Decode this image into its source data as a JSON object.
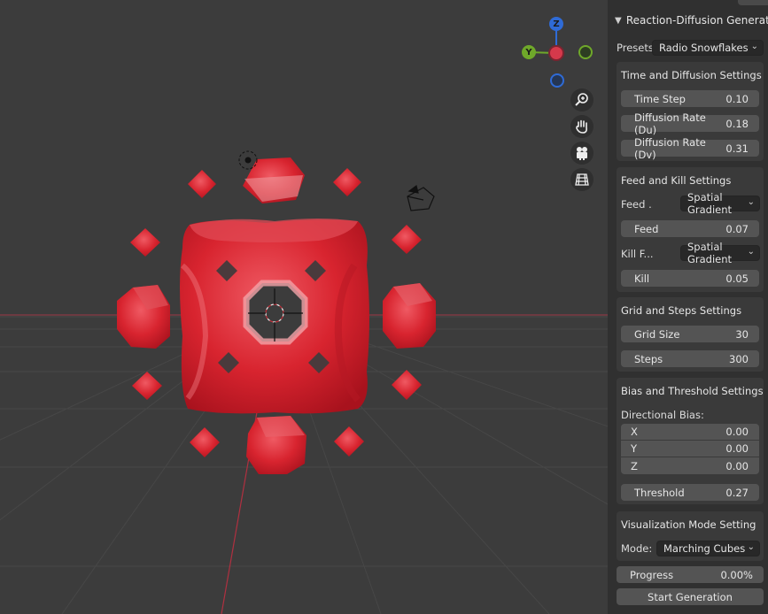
{
  "panel": {
    "title": "Reaction-Diffusion Generator",
    "presets_label": "Presets:",
    "presets_value": "Radio Snowflakes",
    "time_diffusion": {
      "title": "Time and Diffusion Settings",
      "fields": [
        {
          "label": "Time Step",
          "value": "0.10"
        },
        {
          "label": "Diffusion Rate (Du)",
          "value": "0.18"
        },
        {
          "label": "Diffusion Rate (Dv)",
          "value": "0.31"
        }
      ]
    },
    "feed_kill": {
      "title": "Feed and Kill Settings",
      "feed_mode_label": "Feed ...",
      "feed_mode_value": "Spatial Gradient",
      "feed_label": "Feed",
      "feed_value": "0.07",
      "kill_mode_label": "Kill F...",
      "kill_mode_value": "Spatial Gradient",
      "kill_label": "Kill",
      "kill_value": "0.05"
    },
    "grid_steps": {
      "title": "Grid and Steps Settings",
      "grid_label": "Grid Size",
      "grid_value": "30",
      "steps_label": "Steps",
      "steps_value": "300"
    },
    "bias_threshold": {
      "title": "Bias and Threshold Settings",
      "bias_label": "Directional Bias:",
      "bias": [
        {
          "axis": "X",
          "value": "0.00"
        },
        {
          "axis": "Y",
          "value": "0.00"
        },
        {
          "axis": "Z",
          "value": "0.00"
        }
      ],
      "threshold_label": "Threshold",
      "threshold_value": "0.27"
    },
    "visualization": {
      "title": "Visualization Mode Setting",
      "mode_label": "Mode:",
      "mode_value": "Marching Cubes"
    },
    "progress": {
      "label": "Progress",
      "value_text": "0.00%",
      "fraction": 0.0
    },
    "start_button": "Start Generation"
  },
  "gizmo": {
    "z_label": "Z",
    "y_label": "Y",
    "colors": {
      "z": "#2f6bd6",
      "y": "#6fa82a",
      "x": "#d6394b",
      "x_neg": "#7a2430"
    }
  },
  "nav_icons": [
    "zoom-icon",
    "hand-pan-icon",
    "camera-icon",
    "grid-view-icon"
  ],
  "colors": {
    "object": "#d4202e",
    "object_highlight": "#ef6670",
    "axis_line": "#b03040",
    "panel_bg": "#303030",
    "viewport_bg": "#3c3c3c"
  }
}
